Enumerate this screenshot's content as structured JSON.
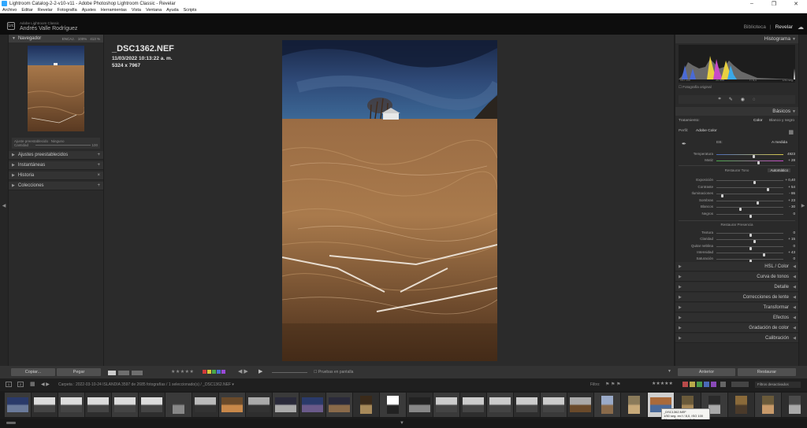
{
  "window": {
    "title": "Lightroom Catalog-2-2-v10-v11 - Adobe Photoshop Lightroom Classic - Revelar",
    "controls": [
      "–",
      "❐",
      "✕"
    ]
  },
  "menu": [
    "Archivo",
    "Editar",
    "Revelar",
    "Fotografía",
    "Ajustes",
    "Herramientas",
    "Vista",
    "Ventana",
    "Ayuda",
    "Scripts"
  ],
  "identity": {
    "logo": "Lrc",
    "subtitle": "Adobe Lightroom Classic",
    "user": "Andrés Valle Rodríguez"
  },
  "modules": {
    "library": "Biblioteca",
    "develop": "Revelar",
    "separator": "|"
  },
  "left_panel": {
    "navigator": {
      "title": "Navegador",
      "zoom_options": [
        "ENCAJ.",
        "100%",
        "413 %"
      ]
    },
    "presets_preview": {
      "label": "Ajuste preestablecido",
      "value": "Ninguno",
      "amount_label": "Cantidad",
      "amount_value": "100"
    },
    "sections": [
      {
        "label": "Ajustes preestablecidos",
        "plus": "+"
      },
      {
        "label": "Instantáneas",
        "plus": "+"
      },
      {
        "label": "Historia",
        "plus": "×"
      },
      {
        "label": "Colecciones",
        "plus": "+"
      }
    ]
  },
  "photo": {
    "filename": "_DSC1362.NEF",
    "datetime": "11/03/2022 10:13:22 a. m.",
    "dimensions": "5324 x 7967"
  },
  "right_panel": {
    "histogram": {
      "title": "Histograma",
      "exif": [
        "ISO 100",
        "20 mm",
        "f / 8,0",
        "1/50 seg."
      ],
      "original_label": "Fotografía original"
    },
    "basic": {
      "title": "Básicos",
      "treatment_label": "Tratamiento:",
      "treatment_color": "Color",
      "treatment_bw": "Blanco y negro",
      "profile_label": "Perfil:",
      "profile_value": "Adobe Color",
      "wb_label": "EB:",
      "wb_value": "A medida",
      "sliders_wb": [
        {
          "label": "Temperatura",
          "value": "4923",
          "pos": 0.55
        },
        {
          "label": "Matiz",
          "value": "+ 28",
          "pos": 0.62
        }
      ],
      "tone_header": "Restaurar Tono",
      "auto_label": "Automático",
      "sliders_tone": [
        {
          "label": "Exposición",
          "value": "+ 0,40",
          "pos": 0.56
        },
        {
          "label": "Contraste",
          "value": "+ 54",
          "pos": 0.76
        },
        {
          "label": "Iluminaciones",
          "value": "- 86",
          "pos": 0.08
        },
        {
          "label": "Sombras",
          "value": "+ 23",
          "pos": 0.61
        },
        {
          "label": "Blancos",
          "value": "- 30",
          "pos": 0.35
        },
        {
          "label": "Negros",
          "value": "0",
          "pos": 0.5
        }
      ],
      "presence_header": "Restaurar Presencia",
      "sliders_presence": [
        {
          "label": "Textura",
          "value": "0",
          "pos": 0.5
        },
        {
          "label": "Claridad",
          "value": "+ 15",
          "pos": 0.57
        },
        {
          "label": "Quitar neblina",
          "value": "0",
          "pos": 0.5
        },
        {
          "label": "Intensidad",
          "value": "+ 43",
          "pos": 0.71
        },
        {
          "label": "Saturación",
          "value": "0",
          "pos": 0.5
        }
      ]
    },
    "collapsed_sections": [
      {
        "label": "HSL / Color",
        "dim": ""
      },
      {
        "label": "Curva de tonos",
        "dim": ""
      },
      {
        "label": "Detalle",
        "dim": ""
      },
      {
        "label": "Correcciones de lente",
        "dim": ""
      },
      {
        "label": "Transformar",
        "dim": ""
      },
      {
        "label": "Efectos",
        "dim": ""
      },
      {
        "label": "Gradación de color",
        "dim": ""
      },
      {
        "label": "Calibración",
        "dim": ""
      }
    ]
  },
  "toolbar": {
    "copy": "Copiar...",
    "paste": "Pegar",
    "previous": "Anterior",
    "reset": "Restaurar",
    "stars": "★★★★★",
    "proof": "Pruebas en pantalla",
    "label_colors": [
      "#d13a3a",
      "#d6c83a",
      "#4aa84a",
      "#4a6fd6",
      "#9a4ad6"
    ]
  },
  "filmstrip_header": {
    "pages": [
      "1",
      "2"
    ],
    "path": "Carpeta : 2022-03-10-24 ISLANDIA    3597 de 2685 fotografías / 1 seleccionado(s) / _DSC1362.NEF ▾",
    "filter_label": "Filtro:",
    "filter_stars": "★★★★★",
    "filter_select": "Filtros desactivados"
  },
  "tooltip": {
    "line1": "_DSC1362.NEF",
    "line2": "1/50 seg. en f / 8,0, ISO 100",
    "line3": "20 mm (20,0 mm f/1,8)"
  }
}
